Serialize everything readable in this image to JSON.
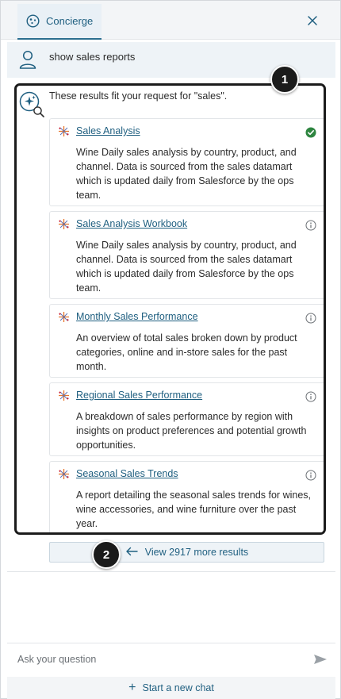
{
  "header": {
    "tab_label": "Concierge",
    "tab_icon": "concierge-sparkle-icon",
    "close_icon": "close-icon"
  },
  "user_message": {
    "text": "show sales reports",
    "icon": "user-icon"
  },
  "results": {
    "intro": "These results fit your request for \"sales\".",
    "items": [
      {
        "title": "Sales Analysis",
        "description": "Wine Daily sales analysis by country, product, and channel. Data is sourced from the sales datamart which is updated daily from Salesforce by the ops team.",
        "status_icon": "certified-check-icon"
      },
      {
        "title": "Sales Analysis Workbook",
        "description": "Wine Daily sales analysis by country, product, and channel. Data is sourced from the sales datamart which is updated daily from Salesforce by the ops team.",
        "status_icon": "info-icon"
      },
      {
        "title": "Monthly Sales Performance",
        "description": "An overview of total sales broken down by product categories, online and in-store sales for the past month.",
        "status_icon": "info-icon"
      },
      {
        "title": "Regional Sales Performance",
        "description": "A breakdown of sales performance by region with insights on product preferences and potential growth opportunities.",
        "status_icon": "info-icon"
      },
      {
        "title": "Seasonal Sales Trends",
        "description": "A report detailing the seasonal sales trends for wines, wine accessories, and wine furniture over the past year.",
        "status_icon": "info-icon"
      }
    ],
    "view_more_label": "View 2917 more results"
  },
  "callouts": {
    "one": "1",
    "two": "2"
  },
  "input": {
    "placeholder": "Ask your question",
    "send_icon": "send-icon"
  },
  "footer": {
    "new_chat_label": "Start a new chat"
  },
  "colors": {
    "accent": "#1f5f80",
    "certified": "#2e8540",
    "callout": "#1b1b1b"
  }
}
